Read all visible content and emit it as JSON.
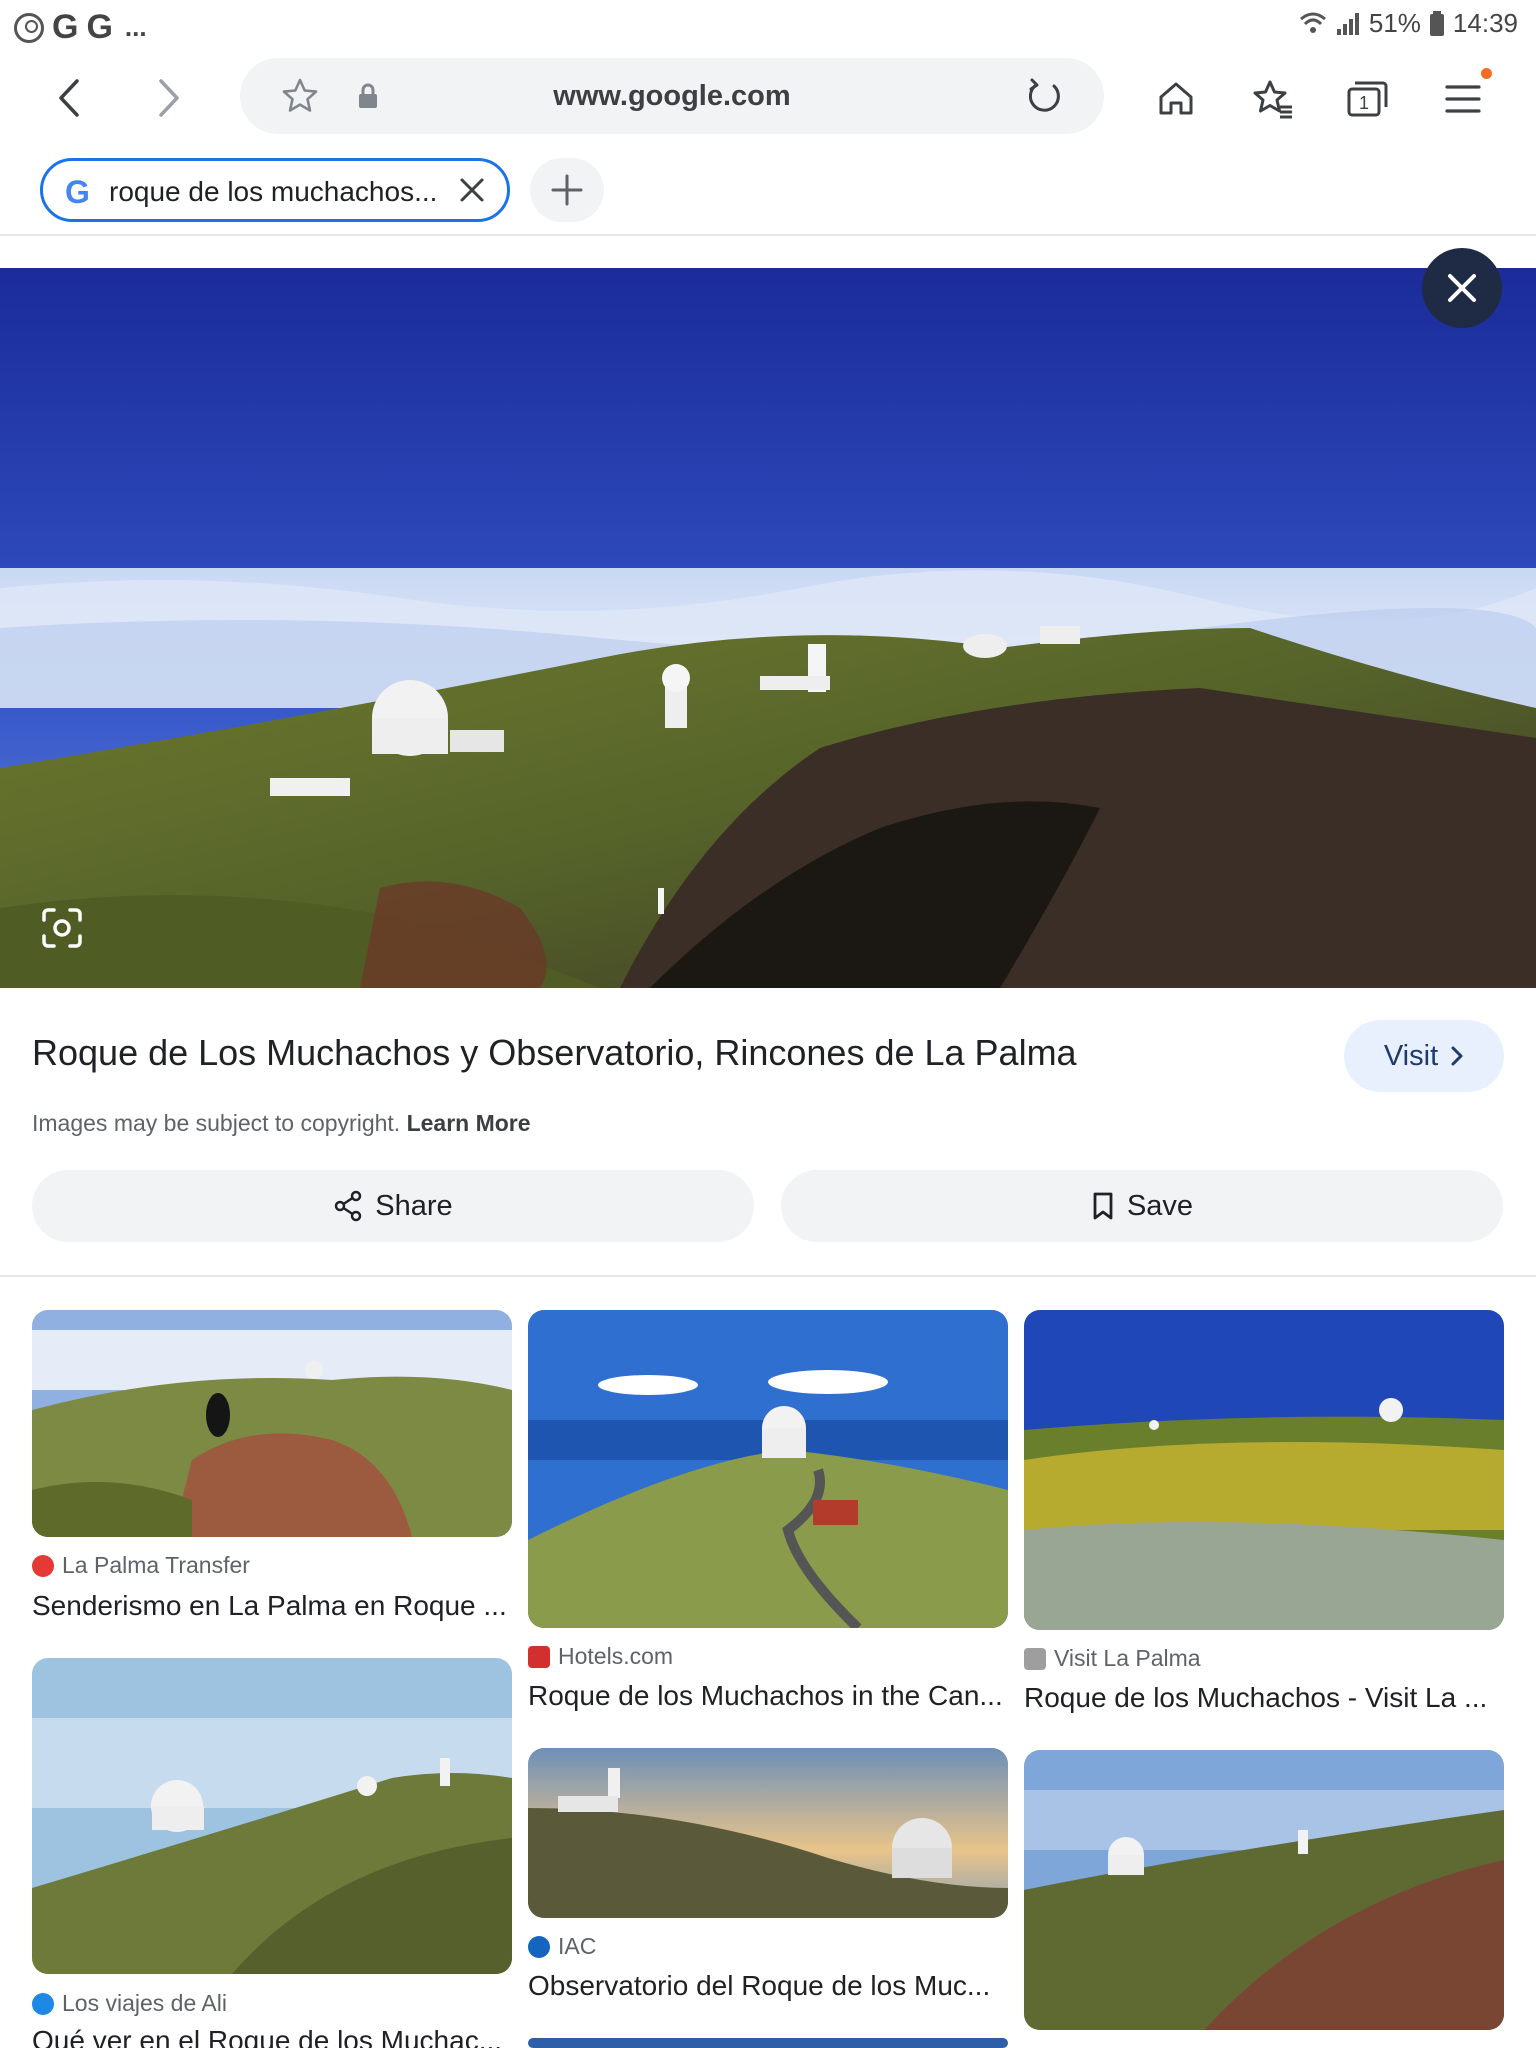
{
  "status_bar": {
    "notification_letters": [
      "G",
      "G"
    ],
    "more": "...",
    "battery": "51%",
    "time": "14:39"
  },
  "browser": {
    "url": "www.google.com",
    "tab_title": "roque de los muchachos...",
    "tab_count": "1"
  },
  "main_result": {
    "title": "Roque de Los Muchachos y Observatorio, Rincones de La Palma",
    "visit_label": "Visit",
    "copyright_text": "Images may be subject to copyright.",
    "learn_more": "Learn More",
    "share_label": "Share",
    "save_label": "Save"
  },
  "results": [
    {
      "source": "La Palma Transfer",
      "title": "Senderismo en La Palma en Roque ...",
      "favicon_color": "#e53935"
    },
    {
      "source": "Hotels.com",
      "title": "Roque de los Muchachos in the Can...",
      "favicon_color": "#d32f2f"
    },
    {
      "source": "Visit La Palma",
      "title": "Roque de los Muchachos - Visit La ...",
      "favicon_color": "#9e9e9e"
    },
    {
      "source": "Los viajes de Ali",
      "title": "Qué ver en el Roque de los Muchac...",
      "favicon_color": "#1e88e5"
    },
    {
      "source": "IAC",
      "title": "Observatorio del Roque de los Muc...",
      "favicon_color": "#1565c0"
    }
  ],
  "icons": {
    "back": "chevron-left-icon",
    "forward": "chevron-right-icon",
    "bookmark_star": "star-icon",
    "lock": "lock-icon",
    "reload": "reload-icon",
    "home": "home-icon",
    "bookmarks": "bookmarks-icon",
    "tabs": "tabs-icon",
    "menu": "menu-icon",
    "close": "close-icon",
    "lens": "lens-icon",
    "share": "share-icon",
    "save": "bookmark-icon",
    "visit": "chevron-right-icon"
  },
  "colors": {
    "accent": "#1a73e8",
    "visit_bg": "#e8f0fe",
    "close_fab": "#1f2b45",
    "notification": "#f26d21"
  }
}
